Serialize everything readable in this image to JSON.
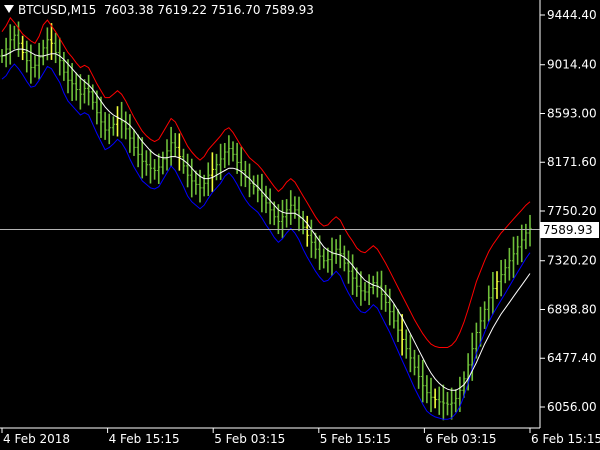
{
  "header": {
    "symbol": "BTCUSD,M15",
    "ohlc": "7603.38 7619.22 7516.70 7589.93"
  },
  "current_price_label": "7589.93",
  "colors": {
    "background": "#000000",
    "axis": "#ffffff",
    "bull_bars": "#6fbf3a",
    "signal_bars": "#f0ff3c",
    "upper_line": "#ff0000",
    "lower_line": "#0000ff",
    "mid_line": "#ffffff",
    "price_line": "#b4b4b4"
  },
  "chart_data": {
    "type": "line",
    "title": "",
    "xlabel": "",
    "ylabel": "",
    "ylim": [
      5900,
      9600
    ],
    "y_ticks": [
      9444.4,
      9014.4,
      8593.0,
      8171.6,
      7750.2,
      7320.2,
      6898.8,
      6477.4,
      6056.0
    ],
    "y_tick_labels": [
      "9444.40",
      "9014.40",
      "8593.00",
      "8171.60",
      "7750.20",
      "7320.20",
      "6898.80",
      "6477.40",
      "6056.00"
    ],
    "x_tick_labels": [
      "4 Feb 2018",
      "4 Feb 15:15",
      "5 Feb 03:15",
      "5 Feb 15:15",
      "6 Feb 03:15",
      "6 Feb 15:15"
    ],
    "x_tick_index": [
      0,
      48,
      96,
      144,
      192,
      240
    ],
    "current_price": 7589.93,
    "series": [
      {
        "key": "close",
        "values": [
          9090,
          9150,
          9230,
          9270,
          9200,
          9120,
          9050,
          8990,
          9010,
          9080,
          9160,
          9230,
          9200,
          9120,
          9050,
          8950,
          8880,
          8850,
          8800,
          8760,
          8810,
          8780,
          8690,
          8600,
          8520,
          8450,
          8470,
          8500,
          8550,
          8520,
          8460,
          8380,
          8300,
          8240,
          8180,
          8150,
          8120,
          8100,
          8130,
          8200,
          8270,
          8340,
          8300,
          8220,
          8140,
          8060,
          8010,
          7980,
          7950,
          7990,
          8060,
          8110,
          8150,
          8200,
          8260,
          8290,
          8240,
          8170,
          8100,
          8040,
          7990,
          7960,
          7930,
          7880,
          7820,
          7760,
          7700,
          7660,
          7700,
          7760,
          7800,
          7760,
          7690,
          7610,
          7540,
          7480,
          7420,
          7360,
          7320,
          7330,
          7380,
          7420,
          7380,
          7300,
          7230,
          7170,
          7100,
          7060,
          7050,
          7090,
          7130,
          7100,
          7030,
          6960,
          6880,
          6800,
          6720,
          6640,
          6560,
          6480,
          6400,
          6320,
          6240,
          6180,
          6140,
          6120,
          6100,
          6090,
          6080,
          6090,
          6130,
          6200,
          6300,
          6420,
          6560,
          6700,
          6800,
          6900,
          7000,
          7080,
          7140,
          7200,
          7260,
          7320,
          7380,
          7440,
          7500,
          7560,
          7600
        ]
      },
      {
        "key": "mid",
        "values": [
          9090,
          9100,
          9120,
          9140,
          9150,
          9150,
          9140,
          9120,
          9100,
          9090,
          9090,
          9100,
          9110,
          9110,
          9090,
          9060,
          9020,
          8980,
          8940,
          8900,
          8870,
          8840,
          8800,
          8750,
          8700,
          8650,
          8610,
          8580,
          8560,
          8540,
          8520,
          8490,
          8450,
          8400,
          8350,
          8310,
          8270,
          8240,
          8220,
          8210,
          8210,
          8220,
          8220,
          8210,
          8190,
          8160,
          8120,
          8080,
          8050,
          8030,
          8030,
          8040,
          8060,
          8080,
          8100,
          8120,
          8120,
          8110,
          8090,
          8060,
          8030,
          7990,
          7960,
          7920,
          7880,
          7840,
          7800,
          7760,
          7740,
          7730,
          7730,
          7730,
          7710,
          7680,
          7640,
          7590,
          7540,
          7490,
          7440,
          7410,
          7390,
          7380,
          7370,
          7350,
          7320,
          7280,
          7230,
          7190,
          7150,
          7130,
          7110,
          7100,
          7080,
          7040,
          7000,
          6950,
          6890,
          6830,
          6760,
          6690,
          6620,
          6550,
          6480,
          6410,
          6350,
          6300,
          6260,
          6230,
          6210,
          6200,
          6200,
          6220,
          6250,
          6300,
          6370,
          6440,
          6520,
          6600,
          6670,
          6740,
          6800,
          6860,
          6910,
          6960,
          7010,
          7060,
          7110,
          7160,
          7210
        ]
      },
      {
        "key": "upper",
        "values": [
          9300,
          9350,
          9420,
          9380,
          9330,
          9280,
          9250,
          9220,
          9200,
          9260,
          9360,
          9400,
          9350,
          9300,
          9240,
          9180,
          9120,
          9080,
          9030,
          8990,
          9010,
          8990,
          8920,
          8850,
          8790,
          8730,
          8730,
          8760,
          8790,
          8760,
          8700,
          8630,
          8560,
          8500,
          8440,
          8400,
          8370,
          8350,
          8370,
          8430,
          8490,
          8550,
          8520,
          8450,
          8380,
          8310,
          8260,
          8220,
          8190,
          8220,
          8280,
          8320,
          8360,
          8400,
          8450,
          8470,
          8430,
          8370,
          8310,
          8260,
          8210,
          8180,
          8150,
          8110,
          8060,
          8010,
          7960,
          7920,
          7950,
          8000,
          8030,
          8000,
          7940,
          7880,
          7820,
          7760,
          7700,
          7650,
          7620,
          7630,
          7670,
          7700,
          7670,
          7600,
          7540,
          7490,
          7430,
          7400,
          7390,
          7420,
          7450,
          7420,
          7360,
          7300,
          7230,
          7160,
          7090,
          7020,
          6950,
          6880,
          6810,
          6750,
          6690,
          6640,
          6600,
          6580,
          6570,
          6570,
          6570,
          6590,
          6630,
          6700,
          6790,
          6900,
          7020,
          7140,
          7230,
          7320,
          7400,
          7460,
          7510,
          7560,
          7600,
          7640,
          7680,
          7720,
          7760,
          7800,
          7830
        ]
      },
      {
        "key": "lower",
        "values": [
          8890,
          8920,
          8980,
          9020,
          8980,
          8930,
          8870,
          8820,
          8830,
          8880,
          8940,
          9000,
          8980,
          8920,
          8860,
          8770,
          8700,
          8660,
          8620,
          8580,
          8600,
          8580,
          8500,
          8420,
          8350,
          8280,
          8300,
          8330,
          8370,
          8340,
          8280,
          8200,
          8130,
          8070,
          8010,
          7980,
          7950,
          7940,
          7960,
          8020,
          8080,
          8140,
          8100,
          8030,
          7960,
          7880,
          7830,
          7800,
          7770,
          7800,
          7860,
          7910,
          7950,
          7990,
          8050,
          8080,
          8040,
          7980,
          7910,
          7850,
          7800,
          7770,
          7740,
          7690,
          7630,
          7580,
          7520,
          7480,
          7510,
          7560,
          7600,
          7560,
          7500,
          7420,
          7350,
          7290,
          7230,
          7180,
          7140,
          7150,
          7190,
          7230,
          7190,
          7110,
          7040,
          6980,
          6920,
          6880,
          6870,
          6900,
          6940,
          6910,
          6840,
          6770,
          6700,
          6620,
          6540,
          6460,
          6380,
          6300,
          6220,
          6150,
          6080,
          6020,
          5990,
          5970,
          5960,
          5950,
          5950,
          5960,
          6000,
          6060,
          6150,
          6260,
          6390,
          6520,
          6610,
          6700,
          6790,
          6860,
          6920,
          6980,
          7040,
          7100,
          7160,
          7220,
          7280,
          7340,
          7390
        ]
      }
    ]
  }
}
